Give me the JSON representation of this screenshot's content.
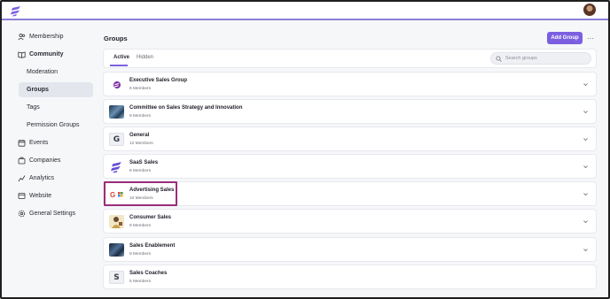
{
  "app": {
    "brand_color": "#7b5fe0",
    "highlight_color": "#9b2d7a"
  },
  "sidebar": {
    "items": [
      {
        "label": "Membership",
        "icon": "users-icon"
      },
      {
        "label": "Community",
        "icon": "book-open-icon"
      },
      {
        "label": "Moderation"
      },
      {
        "label": "Groups"
      },
      {
        "label": "Tags"
      },
      {
        "label": "Permission Groups"
      },
      {
        "label": "Events",
        "icon": "calendar-icon"
      },
      {
        "label": "Companies",
        "icon": "building-icon"
      },
      {
        "label": "Analytics",
        "icon": "chart-line-icon"
      },
      {
        "label": "Website",
        "icon": "globe-icon"
      },
      {
        "label": "General Settings",
        "icon": "gear-icon"
      }
    ],
    "active": "Groups"
  },
  "main": {
    "title": "Groups",
    "add_button": "Add Group",
    "more_button": "···",
    "tabs": [
      {
        "label": "Active"
      },
      {
        "label": "Hidden"
      }
    ],
    "active_tab": "Active",
    "search": {
      "placeholder": "Search groups"
    },
    "groups": [
      {
        "name": "Executive Sales Group",
        "members": "6 Members",
        "thumb": "purple-logo"
      },
      {
        "name": "Committee on Sales Strategy and Innovation",
        "members": "9 Members",
        "thumb": "photo"
      },
      {
        "name": "General",
        "members": "12 Members",
        "thumb": "G"
      },
      {
        "name": "SaaS Sales",
        "members": "8 Members",
        "thumb": "brand-logo"
      },
      {
        "name": "Advertising Sales",
        "members": "10 Members",
        "thumb": "google-logo"
      },
      {
        "name": "Consumer Sales",
        "members": "8 Members",
        "thumb": "illustration"
      },
      {
        "name": "Sales Enablement",
        "members": "9 Members",
        "thumb": "photo"
      },
      {
        "name": "Sales Coaches",
        "members": "5 Members",
        "thumb": "S"
      }
    ]
  }
}
